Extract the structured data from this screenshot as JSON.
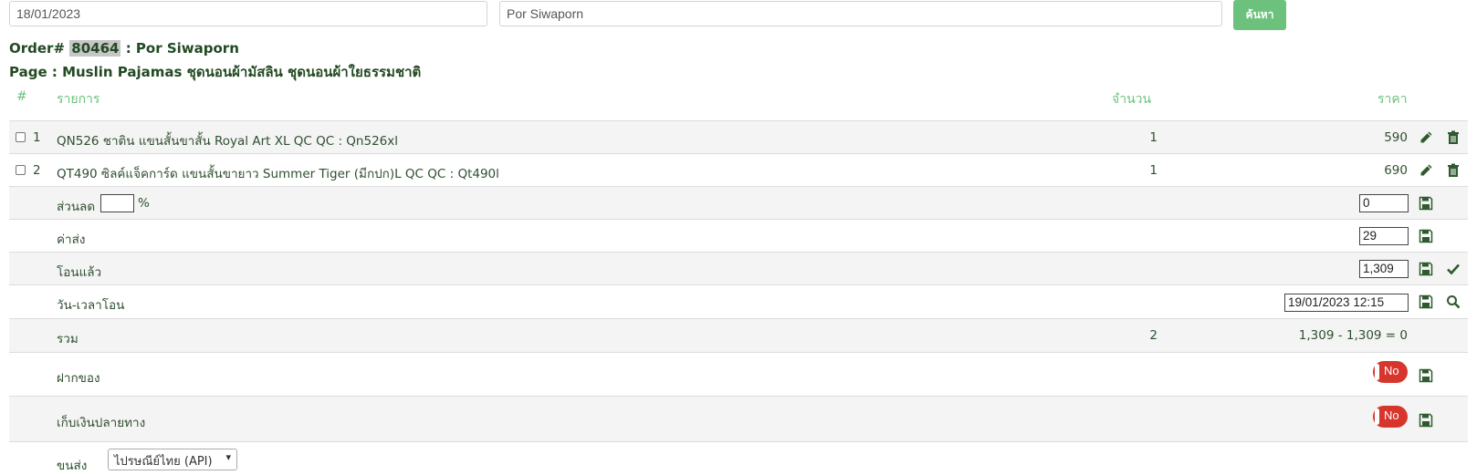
{
  "search": {
    "date_value": "18/01/2023",
    "name_value": "Por Siwaporn",
    "button_label": "ค้นหา"
  },
  "order": {
    "prefix": "Order#",
    "number": "80464",
    "separator": ":",
    "customer": "Por Siwaporn",
    "page_line": "Page : Muslin Pajamas ชุดนอนผ้ามัสลิน ชุดนอนผ้าใยธรรมชาติ"
  },
  "table": {
    "headers": {
      "index": "#",
      "item": "รายการ",
      "quantity": "จำนวน",
      "price": "ราคา"
    },
    "items": [
      {
        "index": "1",
        "name": "QN526 ชาติน แขนสั้นขาสั้น Royal Art XL QC QC : Qn526xl",
        "quantity": "1",
        "price": "590"
      },
      {
        "index": "2",
        "name": "QT490 ซิลค์แจ็คการ์ด แขนสั้นขายาว Summer Tiger (มีกปก)L QC QC : Qt490l",
        "quantity": "1",
        "price": "690"
      }
    ]
  },
  "discount": {
    "label": "ส่วนลด",
    "percent_value": "",
    "percent_sign": "%",
    "value": "0"
  },
  "shipping": {
    "label": "ค่าส่ง",
    "value": "29"
  },
  "transferred": {
    "label": "โอนแล้ว",
    "value": "1,309"
  },
  "transfer_datetime": {
    "label": "วัน-เวลาโอน",
    "value": "19/01/2023 12:15"
  },
  "total": {
    "label": "รวม",
    "quantity": "2",
    "summary": "1,309 - 1,309 = 0"
  },
  "deposit": {
    "label": "ฝากของ",
    "toggle_label": "No"
  },
  "cod": {
    "label": "เก็บเงินปลายทาง",
    "toggle_label": "No"
  },
  "carrier": {
    "label": "ขนส่ง",
    "selected": "ไปรษณีย์ไทย (API)"
  },
  "colors": {
    "accent": "#6cc27d",
    "toggle_off": "#d6362c",
    "text": "#2f4f2f"
  },
  "icons": [
    "pencil-icon",
    "trash-icon",
    "floppy-disk-icon",
    "checkmark-icon",
    "magnifier-icon",
    "chevron-down-icon"
  ]
}
